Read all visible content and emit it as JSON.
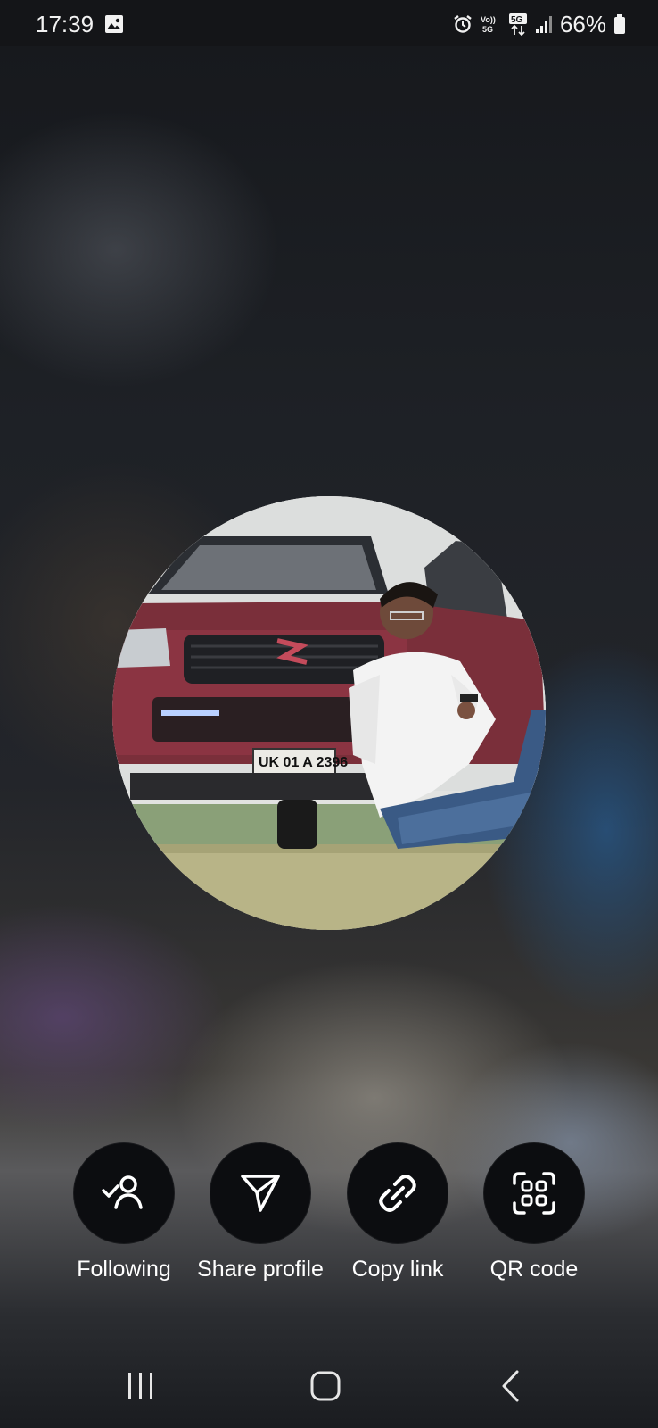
{
  "status_bar": {
    "time": "17:39",
    "battery_percent": "66%",
    "network_label": "5G",
    "icons": [
      "image-notification-icon",
      "alarm-icon",
      "volte-icon",
      "5g-data-icon",
      "signal-icon",
      "battery-icon"
    ]
  },
  "profile": {
    "photo": "profile-photo"
  },
  "actions": [
    {
      "label": "Following",
      "icon": "following-person-check-icon"
    },
    {
      "label": "Share profile",
      "icon": "send-paper-plane-icon"
    },
    {
      "label": "Copy link",
      "icon": "link-icon"
    },
    {
      "label": "QR code",
      "icon": "qr-code-icon"
    }
  ],
  "nav": {
    "buttons": [
      "recents-icon",
      "home-icon",
      "back-icon"
    ]
  },
  "colors": {
    "action_circle": "#0c0d10",
    "text": "#ffffff"
  }
}
